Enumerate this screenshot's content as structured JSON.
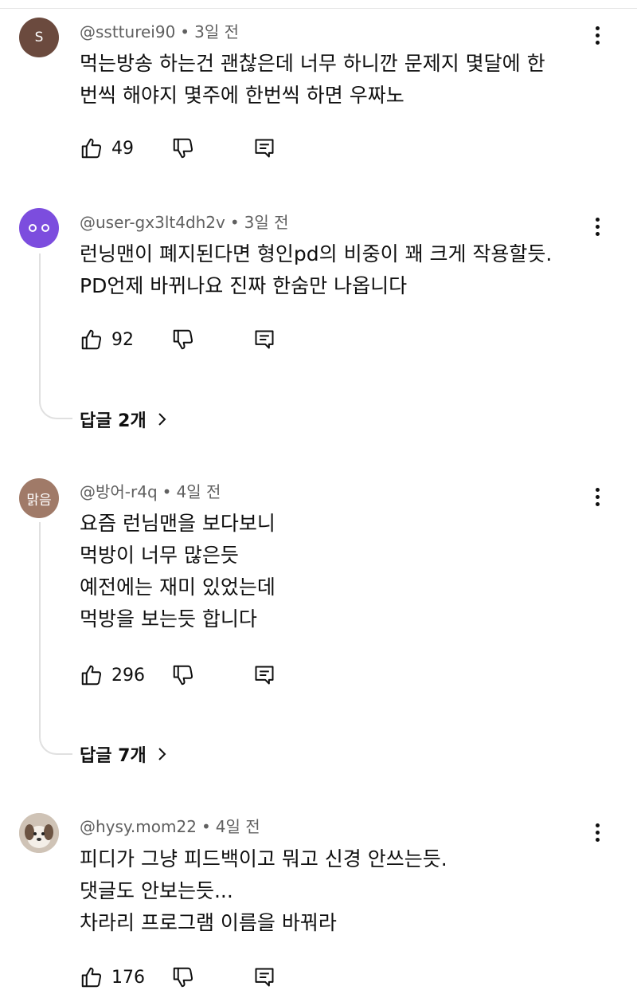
{
  "comments": [
    {
      "avatar_text": "S",
      "avatar_color": "#6b4a3e",
      "author": "@sstturei90",
      "time": "3일 전",
      "text": "먹는방송 하는건 괜찮은데 너무 하니깐 문제지 몇달에 한\n번씩 해야지 몇주에 한번씩 하면 우짜노",
      "likes": "49"
    },
    {
      "avatar_text": "",
      "avatar_color": "#7c4dde",
      "author": "@user-gx3lt4dh2v",
      "time": "3일 전",
      "text": "런닝맨이 폐지된다면 형인pd의 비중이 꽤 크게 작용할듯.\nPD언제 바뀌나요 진짜 한숨만 나옵니다",
      "likes": "92",
      "replies": "답글 2개"
    },
    {
      "avatar_text": "맑음",
      "avatar_color": "#a07a68",
      "author": "@방어-r4q",
      "time": "4일 전",
      "text": "요즘 런님맨을 보다보니\n먹방이 너무 많은듯\n예전에는 재미 있었는데\n먹방을 보는듯 합니다",
      "likes": "296",
      "replies": "답글 7개"
    },
    {
      "avatar_text": "",
      "avatar_color": "#d9cfc4",
      "author": "@hysy.mom22",
      "time": "4일 전",
      "text": "피디가 그냥 피드백이고 뭐고 신경 안쓰는듯.\n댓글도 안보는듯...\n차라리 프로그램 이름을 바꿔라",
      "likes": "176"
    }
  ],
  "icons": {
    "like": "thumbs-up-icon",
    "dislike": "thumbs-down-icon",
    "reply": "reply-comment-icon",
    "more": "more-vertical-icon",
    "chevron": "chevron-right-icon"
  }
}
